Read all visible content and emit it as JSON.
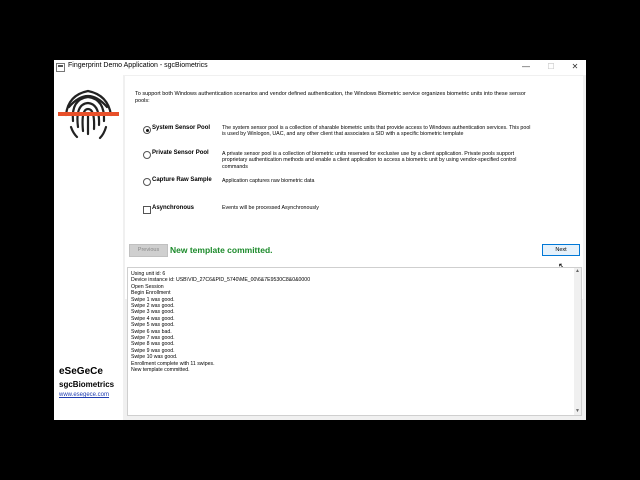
{
  "window": {
    "title": "Fingerprint Demo Application - sgcBiometrics",
    "minimize": "—",
    "maximize": "☐",
    "close": "✕"
  },
  "sidebar": {
    "brand_name": "eSeGeCe",
    "product": "sgcBiometrics",
    "link": "www.esegece.com",
    "logo_color": "#e8502a"
  },
  "intro": "To support both Windows authentication scenarios and vendor defined authentication, the Windows Biometric service organizes biometric units into these sensor pools:",
  "options": [
    {
      "label": "System Sensor Pool",
      "selected": true,
      "description": "The system sensor pool is a collection of sharable biometric units that provide access to Windows authentication services. This pool is used by Winlogon, UAC, and any other client that associates a SID with a specific biometric template"
    },
    {
      "label": "Private Sensor Pool",
      "selected": false,
      "description": "A private sensor pool is a collection of biometric units reserved for exclusive use by a client application. Private pools support proprietary authentication methods and enable a client application to access a biometric unit by using vendor-specified control commands"
    },
    {
      "label": "Capture Raw Sample",
      "selected": false,
      "description": "Application captures raw biometric data"
    }
  ],
  "async_option": {
    "label": "Asynchronous",
    "checked": false,
    "description": "Events will be processed Asynchronously"
  },
  "buttons": {
    "previous": "Previous",
    "next": "Next"
  },
  "status": {
    "text": "New template committed.",
    "color": "#1b8a2a"
  },
  "log": [
    "Using unit id: 6",
    "Device instance id: USB\\VID_27C6&PID_5740\\ME_00\\6&7E9530C8&0&0000",
    "Open Session",
    "Begin Enrollment",
    "Swipe 1 was good.",
    "Swipe 2 was good.",
    "Swipe 3 was good.",
    "Swipe 4 was good.",
    "Swipe 5 was good.",
    "Swipe 6 was bad.",
    "Swipe 7 was good.",
    "Swipe 8 was good.",
    "Swipe 9 was good.",
    "Swipe 10 was good.",
    "Enrollment complete with 11 swipes.",
    "New template committed."
  ]
}
